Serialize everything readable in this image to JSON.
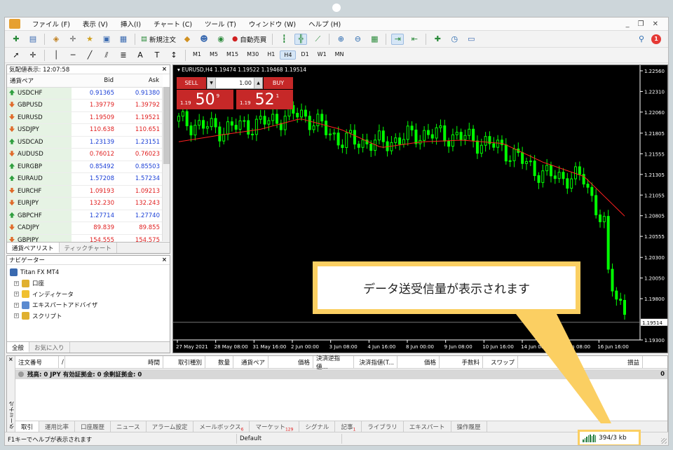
{
  "menu": [
    "ファイル (F)",
    "表示 (V)",
    "挿入(I)",
    "チャート (C)",
    "ツール (T)",
    "ウィンドウ (W)",
    "ヘルプ (H)"
  ],
  "toolbar": {
    "new_order": "新規注文",
    "auto_trade": "自動売買",
    "notifications_count": "1",
    "timeframes": [
      "M1",
      "M5",
      "M15",
      "M30",
      "H1",
      "H4",
      "D1",
      "W1",
      "MN"
    ],
    "selected_timeframe": "H4",
    "text_tool": "A"
  },
  "market_watch": {
    "title": "気配値表示: 12:07:58",
    "col_symbol": "通貨ペア",
    "col_bid": "Bid",
    "col_ask": "Ask",
    "rows": [
      {
        "symbol": "USDCHF",
        "bid": "0.91365",
        "ask": "0.91380",
        "dir": "up",
        "color": "#1a3fd6"
      },
      {
        "symbol": "GBPUSD",
        "bid": "1.39779",
        "ask": "1.39792",
        "dir": "dn",
        "color": "#e02020"
      },
      {
        "symbol": "EURUSD",
        "bid": "1.19509",
        "ask": "1.19521",
        "dir": "dn",
        "color": "#e02020"
      },
      {
        "symbol": "USDJPY",
        "bid": "110.638",
        "ask": "110.651",
        "dir": "dn",
        "color": "#e02020"
      },
      {
        "symbol": "USDCAD",
        "bid": "1.23139",
        "ask": "1.23151",
        "dir": "up",
        "color": "#1a3fd6"
      },
      {
        "symbol": "AUDUSD",
        "bid": "0.76012",
        "ask": "0.76023",
        "dir": "dn",
        "color": "#e02020"
      },
      {
        "symbol": "EURGBP",
        "bid": "0.85492",
        "ask": "0.85503",
        "dir": "up",
        "color": "#1a3fd6"
      },
      {
        "symbol": "EURAUD",
        "bid": "1.57208",
        "ask": "1.57234",
        "dir": "up",
        "color": "#1a3fd6"
      },
      {
        "symbol": "EURCHF",
        "bid": "1.09193",
        "ask": "1.09213",
        "dir": "dn",
        "color": "#e02020"
      },
      {
        "symbol": "EURJPY",
        "bid": "132.230",
        "ask": "132.243",
        "dir": "dn",
        "color": "#e02020"
      },
      {
        "symbol": "GBPCHF",
        "bid": "1.27714",
        "ask": "1.27740",
        "dir": "up",
        "color": "#1a3fd6"
      },
      {
        "symbol": "CADJPY",
        "bid": "89.839",
        "ask": "89.855",
        "dir": "dn",
        "color": "#e02020"
      },
      {
        "symbol": "GBPJPY",
        "bid": "154.555",
        "ask": "154.575",
        "dir": "dn",
        "color": "#e02020"
      }
    ],
    "tabs": [
      "通貨ペアリスト",
      "ティックチャート"
    ]
  },
  "navigator": {
    "title": "ナビゲーター",
    "root": "Titan FX MT4",
    "items": [
      "口座",
      "インディケータ",
      "エキスパートアドバイザ",
      "スクリプト"
    ],
    "tabs": [
      "全般",
      "お気に入り"
    ]
  },
  "chart": {
    "header": "EURUSD,H4  1.19474 1.19522 1.19468 1.19514",
    "sell_label": "SELL",
    "buy_label": "BUY",
    "lot": "1.00",
    "sell_prefix": "1.19",
    "sell_big": "50",
    "sell_sup": "9",
    "buy_prefix": "1.19",
    "buy_big": "52",
    "buy_sup": "1",
    "price_ticks": [
      "1.22560",
      "1.22310",
      "1.22060",
      "1.21805",
      "1.21555",
      "1.21305",
      "1.21055",
      "1.20805",
      "1.20555",
      "1.20300",
      "1.20050",
      "1.19800",
      "1.19300"
    ],
    "current_price": "1.19514",
    "time_ticks": [
      "27 May 2021",
      "28 May 08:00",
      "31 May 16:00",
      "2 Jun 00:00",
      "3 Jun 08:00",
      "4 Jun 16:00",
      "8 Jun 00:00",
      "9 Jun 08:00",
      "10 Jun 16:00",
      "14 Jun 00:00",
      "15 Jun 08:00",
      "16 Jun 16:00"
    ]
  },
  "chart_data": {
    "type": "line",
    "symbol": "EURUSD",
    "timeframe": "H4",
    "ohlc_header": {
      "open": 1.19474,
      "high": 1.19522,
      "low": 1.19468,
      "close": 1.19514
    },
    "x": [
      "27 May 2021",
      "28 May 08:00",
      "31 May 16:00",
      "2 Jun 00:00",
      "3 Jun 08:00",
      "4 Jun 16:00",
      "8 Jun 00:00",
      "9 Jun 08:00",
      "10 Jun 16:00",
      "14 Jun 00:00",
      "15 Jun 08:00",
      "16 Jun 16:00"
    ],
    "series": [
      {
        "values": [
          1.2195,
          1.2185,
          1.2192,
          1.2205,
          1.2172,
          1.2168,
          1.218,
          1.2176,
          1.2162,
          1.213,
          1.2125,
          1.201
        ]
      },
      {
        "values": [
          1.217,
          1.2178,
          1.2185,
          1.2198,
          1.2185,
          1.2163,
          1.217,
          1.2172,
          1.2168,
          1.2145,
          1.2128,
          1.208
        ]
      }
    ],
    "ylim": [
      1.193,
      1.2256
    ],
    "grid": false,
    "colors": {
      "candles": "#00ff00",
      "ma": "#ff2020",
      "background": "#000000"
    }
  },
  "callout": {
    "text": "データ送受信量が表示されます"
  },
  "terminal": {
    "side_label": "ターミナル",
    "columns": [
      "注文番号",
      "/",
      "時間",
      "取引種別",
      "数量",
      "通貨ペア",
      "価格",
      "決済逆指値...",
      "決済指値(T...",
      "価格",
      "手数料",
      "スワップ",
      "損益"
    ],
    "balance": "残高: 0 JPY  有効証拠金: 0  余剰証拠金: 0",
    "balance_value": "0",
    "tabs": [
      {
        "label": "取引",
        "badge": ""
      },
      {
        "label": "運用比率",
        "badge": ""
      },
      {
        "label": "口座履歴",
        "badge": ""
      },
      {
        "label": "ニュース",
        "badge": ""
      },
      {
        "label": "アラーム設定",
        "badge": ""
      },
      {
        "label": "メールボックス",
        "badge": "6"
      },
      {
        "label": "マーケット",
        "badge": "129"
      },
      {
        "label": "シグナル",
        "badge": ""
      },
      {
        "label": "記事",
        "badge": "1"
      },
      {
        "label": "ライブラリ",
        "badge": ""
      },
      {
        "label": "エキスパート",
        "badge": ""
      },
      {
        "label": "操作履歴",
        "badge": ""
      }
    ]
  },
  "status": {
    "help": "F1キーでヘルプが表示されます",
    "profile": "Default",
    "traffic": "394/3 kb"
  }
}
